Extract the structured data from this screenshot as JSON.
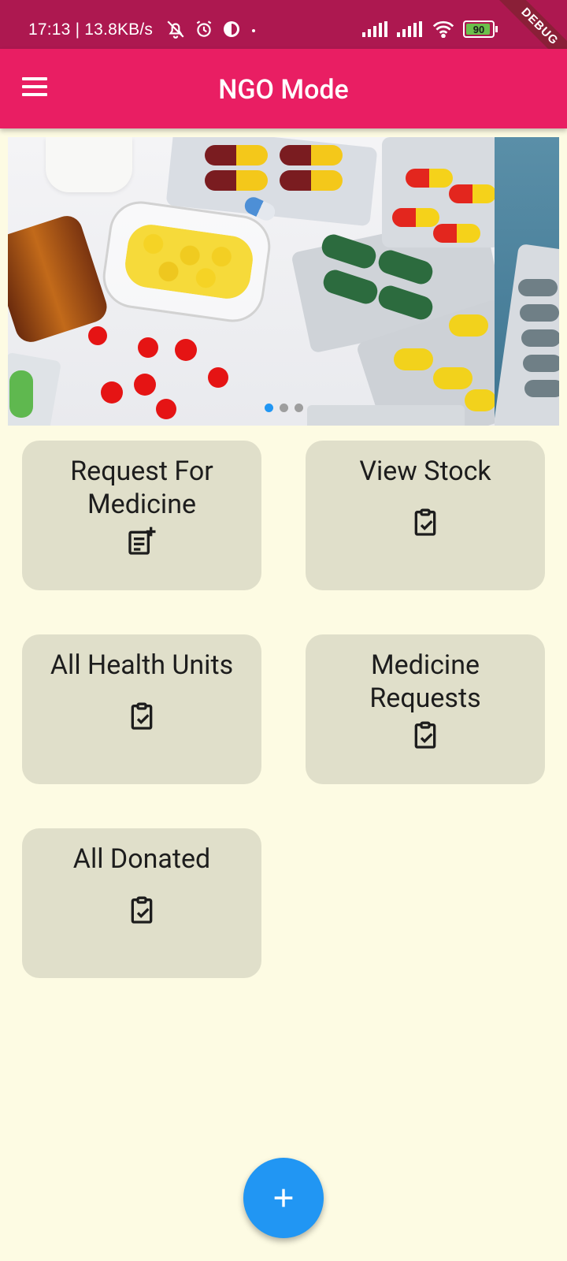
{
  "status_bar": {
    "time": "17:13 | 13.8KB/s",
    "battery": "90",
    "debug": "DEBUG"
  },
  "app_bar": {
    "title": "NGO Mode",
    "menu_icon": "menu-icon"
  },
  "carousel": {
    "slides": 3,
    "active_index": 0
  },
  "cards": [
    {
      "label": "Request For Medicine",
      "icon": "post-add-icon"
    },
    {
      "label": "View Stock",
      "icon": "clipboard-check-icon"
    },
    {
      "label": "All Health Units",
      "icon": "clipboard-check-icon"
    },
    {
      "label": "Medicine Requests",
      "icon": "clipboard-check-icon"
    },
    {
      "label": "All Donated",
      "icon": "clipboard-check-icon"
    }
  ],
  "fab": {
    "icon": "add-icon"
  },
  "colors": {
    "status_bar": "#ad1850",
    "app_bar": "#e91e63",
    "background": "#fdfbe3",
    "card": "#e0dfca",
    "fab": "#2196f3"
  }
}
